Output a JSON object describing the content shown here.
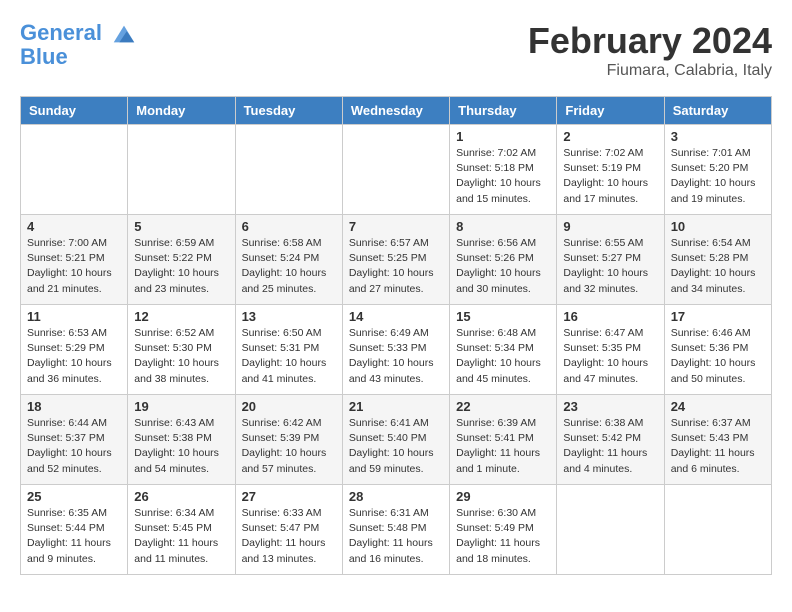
{
  "logo": {
    "line1": "General",
    "line2": "Blue"
  },
  "title": "February 2024",
  "subtitle": "Fiumara, Calabria, Italy",
  "days_of_week": [
    "Sunday",
    "Monday",
    "Tuesday",
    "Wednesday",
    "Thursday",
    "Friday",
    "Saturday"
  ],
  "weeks": [
    [
      {
        "day": "",
        "info": ""
      },
      {
        "day": "",
        "info": ""
      },
      {
        "day": "",
        "info": ""
      },
      {
        "day": "",
        "info": ""
      },
      {
        "day": "1",
        "info": "Sunrise: 7:02 AM\nSunset: 5:18 PM\nDaylight: 10 hours\nand 15 minutes."
      },
      {
        "day": "2",
        "info": "Sunrise: 7:02 AM\nSunset: 5:19 PM\nDaylight: 10 hours\nand 17 minutes."
      },
      {
        "day": "3",
        "info": "Sunrise: 7:01 AM\nSunset: 5:20 PM\nDaylight: 10 hours\nand 19 minutes."
      }
    ],
    [
      {
        "day": "4",
        "info": "Sunrise: 7:00 AM\nSunset: 5:21 PM\nDaylight: 10 hours\nand 21 minutes."
      },
      {
        "day": "5",
        "info": "Sunrise: 6:59 AM\nSunset: 5:22 PM\nDaylight: 10 hours\nand 23 minutes."
      },
      {
        "day": "6",
        "info": "Sunrise: 6:58 AM\nSunset: 5:24 PM\nDaylight: 10 hours\nand 25 minutes."
      },
      {
        "day": "7",
        "info": "Sunrise: 6:57 AM\nSunset: 5:25 PM\nDaylight: 10 hours\nand 27 minutes."
      },
      {
        "day": "8",
        "info": "Sunrise: 6:56 AM\nSunset: 5:26 PM\nDaylight: 10 hours\nand 30 minutes."
      },
      {
        "day": "9",
        "info": "Sunrise: 6:55 AM\nSunset: 5:27 PM\nDaylight: 10 hours\nand 32 minutes."
      },
      {
        "day": "10",
        "info": "Sunrise: 6:54 AM\nSunset: 5:28 PM\nDaylight: 10 hours\nand 34 minutes."
      }
    ],
    [
      {
        "day": "11",
        "info": "Sunrise: 6:53 AM\nSunset: 5:29 PM\nDaylight: 10 hours\nand 36 minutes."
      },
      {
        "day": "12",
        "info": "Sunrise: 6:52 AM\nSunset: 5:30 PM\nDaylight: 10 hours\nand 38 minutes."
      },
      {
        "day": "13",
        "info": "Sunrise: 6:50 AM\nSunset: 5:31 PM\nDaylight: 10 hours\nand 41 minutes."
      },
      {
        "day": "14",
        "info": "Sunrise: 6:49 AM\nSunset: 5:33 PM\nDaylight: 10 hours\nand 43 minutes."
      },
      {
        "day": "15",
        "info": "Sunrise: 6:48 AM\nSunset: 5:34 PM\nDaylight: 10 hours\nand 45 minutes."
      },
      {
        "day": "16",
        "info": "Sunrise: 6:47 AM\nSunset: 5:35 PM\nDaylight: 10 hours\nand 47 minutes."
      },
      {
        "day": "17",
        "info": "Sunrise: 6:46 AM\nSunset: 5:36 PM\nDaylight: 10 hours\nand 50 minutes."
      }
    ],
    [
      {
        "day": "18",
        "info": "Sunrise: 6:44 AM\nSunset: 5:37 PM\nDaylight: 10 hours\nand 52 minutes."
      },
      {
        "day": "19",
        "info": "Sunrise: 6:43 AM\nSunset: 5:38 PM\nDaylight: 10 hours\nand 54 minutes."
      },
      {
        "day": "20",
        "info": "Sunrise: 6:42 AM\nSunset: 5:39 PM\nDaylight: 10 hours\nand 57 minutes."
      },
      {
        "day": "21",
        "info": "Sunrise: 6:41 AM\nSunset: 5:40 PM\nDaylight: 10 hours\nand 59 minutes."
      },
      {
        "day": "22",
        "info": "Sunrise: 6:39 AM\nSunset: 5:41 PM\nDaylight: 11 hours\nand 1 minute."
      },
      {
        "day": "23",
        "info": "Sunrise: 6:38 AM\nSunset: 5:42 PM\nDaylight: 11 hours\nand 4 minutes."
      },
      {
        "day": "24",
        "info": "Sunrise: 6:37 AM\nSunset: 5:43 PM\nDaylight: 11 hours\nand 6 minutes."
      }
    ],
    [
      {
        "day": "25",
        "info": "Sunrise: 6:35 AM\nSunset: 5:44 PM\nDaylight: 11 hours\nand 9 minutes."
      },
      {
        "day": "26",
        "info": "Sunrise: 6:34 AM\nSunset: 5:45 PM\nDaylight: 11 hours\nand 11 minutes."
      },
      {
        "day": "27",
        "info": "Sunrise: 6:33 AM\nSunset: 5:47 PM\nDaylight: 11 hours\nand 13 minutes."
      },
      {
        "day": "28",
        "info": "Sunrise: 6:31 AM\nSunset: 5:48 PM\nDaylight: 11 hours\nand 16 minutes."
      },
      {
        "day": "29",
        "info": "Sunrise: 6:30 AM\nSunset: 5:49 PM\nDaylight: 11 hours\nand 18 minutes."
      },
      {
        "day": "",
        "info": ""
      },
      {
        "day": "",
        "info": ""
      }
    ]
  ]
}
